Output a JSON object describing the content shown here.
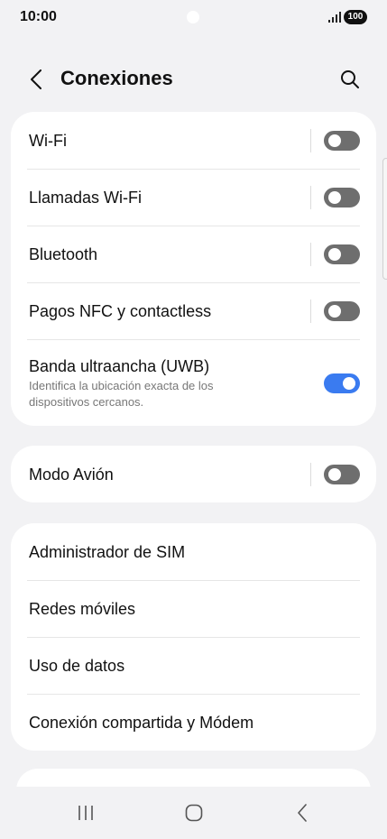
{
  "status_bar": {
    "time": "10:00",
    "battery": "100",
    "signal_icon": "signal-bars-icon"
  },
  "header": {
    "title": "Conexiones",
    "back_icon": "chevron-left-icon",
    "search_icon": "search-icon"
  },
  "cards": {
    "wireless": [
      {
        "label": "Wi-Fi",
        "toggle": "off"
      },
      {
        "label": "Llamadas Wi-Fi",
        "toggle": "off"
      },
      {
        "label": "Bluetooth",
        "toggle": "off"
      },
      {
        "label": "Pagos NFC y contactless",
        "toggle": "off"
      },
      {
        "label": "Banda ultraancha (UWB)",
        "description": "Identifica la ubicación exacta de los dispositivos cercanos.",
        "toggle": "on"
      }
    ],
    "airplane": [
      {
        "label": "Modo Avión",
        "toggle": "off"
      }
    ],
    "network": [
      {
        "label": "Administrador de SIM"
      },
      {
        "label": "Redes móviles"
      },
      {
        "label": "Uso de datos"
      },
      {
        "label": "Conexión compartida y Módem"
      }
    ]
  },
  "colors": {
    "background": "#f2f2f4",
    "card": "#ffffff",
    "toggle_on": "#3a7bf0",
    "toggle_off": "#6e6e6e"
  },
  "nav_bar": {
    "recents_icon": "recents-icon",
    "home_icon": "home-icon",
    "back_icon": "back-icon"
  }
}
